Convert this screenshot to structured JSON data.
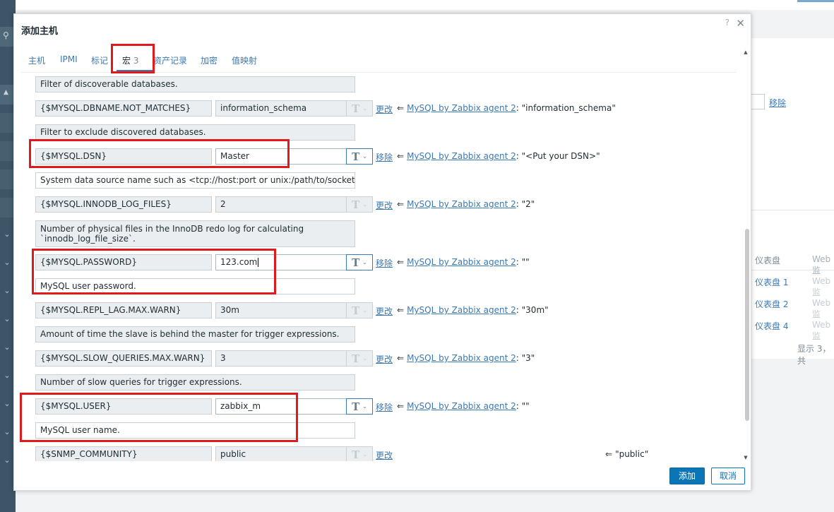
{
  "background": {
    "remove_label": "移除",
    "table_header": "仪表盘",
    "table_header2": "Web监",
    "rows": [
      {
        "name": "仪表盘 1",
        "web": "Web监"
      },
      {
        "name": "仪表盘 2",
        "web": "Web监"
      },
      {
        "name": "仪表盘 4",
        "web": "Web监"
      }
    ],
    "footer": "显示 3，共"
  },
  "dialog": {
    "title": "添加主机",
    "help": "?",
    "close": "✕",
    "tabs": [
      {
        "label": "主机"
      },
      {
        "label": "IPMI"
      },
      {
        "label": "标记"
      },
      {
        "label": "宏",
        "count": "3"
      },
      {
        "label": "资产记录"
      },
      {
        "label": "加密"
      },
      {
        "label": "值映射"
      }
    ],
    "macros": [
      {
        "desc": "Filter of discoverable databases."
      },
      {
        "macro": "{$MYSQL.DBNAME.NOT_MATCHES}",
        "value": "information_schema",
        "action": "更改",
        "template": "MySQL by Zabbix agent 2",
        "default": ": \"information_schema\"",
        "desc": "Filter to exclude discovered databases."
      },
      {
        "macro": "{$MYSQL.DSN}",
        "value": "Master",
        "action": "移除",
        "template": "MySQL by Zabbix agent 2",
        "default": ": \"<Put your DSN>\"",
        "desc": "System data source name such as <tcp://host:port or unix:/path/to/socket)/>."
      },
      {
        "macro": "{$MYSQL.INNODB_LOG_FILES}",
        "value": "2",
        "action": "更改",
        "template": "MySQL by Zabbix agent 2",
        "default": ": \"2\"",
        "desc": "Number of physical files in the InnoDB redo log for calculating `innodb_log_file_size`."
      },
      {
        "macro": "{$MYSQL.PASSWORD}",
        "value": "123.com",
        "action": "移除",
        "template": "MySQL by Zabbix agent 2",
        "default": ": \"\"",
        "desc": "MySQL user password."
      },
      {
        "macro": "{$MYSQL.REPL_LAG.MAX.WARN}",
        "value": "30m",
        "action": "更改",
        "template": "MySQL by Zabbix agent 2",
        "default": ": \"30m\"",
        "desc": "Amount of time the slave is behind the master for trigger expressions."
      },
      {
        "macro": "{$MYSQL.SLOW_QUERIES.MAX.WARN}",
        "value": "3",
        "action": "更改",
        "template": "MySQL by Zabbix agent 2",
        "default": ": \"3\"",
        "desc": "Number of slow queries for trigger expressions."
      },
      {
        "macro": "{$MYSQL.USER}",
        "value": "zabbix_m",
        "action": "移除",
        "template": "MySQL by Zabbix agent 2",
        "default": ": \"\"",
        "desc": "MySQL user name."
      },
      {
        "macro": "{$SNMP_COMMUNITY}",
        "value": "public",
        "action": "更改",
        "default": "\"public\""
      }
    ],
    "arrow": "⇐",
    "type_glyph": "T",
    "add_button": "添加",
    "cancel_button": "取消"
  },
  "colors": {
    "link": "#3b79b3",
    "primary": "#0c75b5",
    "highlight": "#e0191c"
  }
}
